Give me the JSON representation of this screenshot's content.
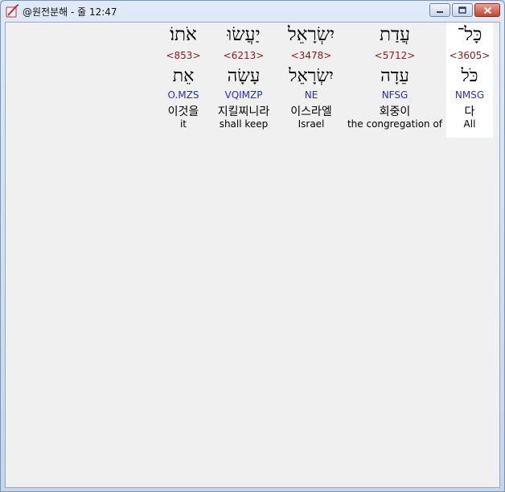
{
  "window": {
    "title": "@원전분해 - 줄 12:47",
    "icon": "pen-notebook-icon",
    "buttons": [
      "minimize-icon",
      "maximize-icon",
      "close-icon"
    ]
  },
  "words": [
    {
      "hebrew": "אֹתוֹ׃",
      "strong": "<853>",
      "root": "אֵת",
      "parse": "O.MZS",
      "korean": "이것을",
      "english": "it",
      "selected": false
    },
    {
      "hebrew": "יַעֲשׂוּ",
      "strong": "<6213>",
      "root": "עָשָׂה",
      "parse": "VQIMZP",
      "korean": "지킬찌니라",
      "english": "shall keep",
      "selected": false
    },
    {
      "hebrew": "יִשְׂרָאֵל",
      "strong": "<3478>",
      "root": "יִשְׂרָאֵל",
      "parse": "NE",
      "korean": "이스라엘",
      "english": "Israel",
      "selected": false
    },
    {
      "hebrew": "עֲדַת",
      "strong": "<5712>",
      "root": "עֵדָה",
      "parse": "NFSG",
      "korean": "회중이",
      "english": "the congregation of",
      "selected": false
    },
    {
      "hebrew": "כָּל־",
      "strong": "<3605>",
      "root": "כֹּל",
      "parse": "NMSG",
      "korean": "다",
      "english": "All",
      "selected": true
    }
  ],
  "colors": {
    "strong": "#8b1a1a",
    "parse": "#2a2ad0",
    "selected_background": "#ffffff",
    "client_background": "#f0f0f0"
  }
}
